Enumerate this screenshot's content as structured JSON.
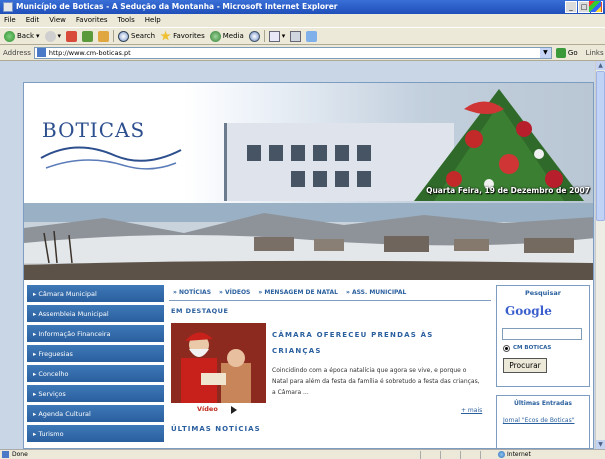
{
  "window": {
    "title": "Município de Boticas - A Sedução da Montanha - Microsoft Internet Explorer",
    "controls": [
      "_",
      "□",
      "✕"
    ]
  },
  "menu": [
    "File",
    "Edit",
    "View",
    "Favorites",
    "Tools",
    "Help"
  ],
  "toolbar": {
    "back": "Back",
    "search": "Search",
    "favorites": "Favorites",
    "media": "Media"
  },
  "address": {
    "label": "Address",
    "url": "http://www.cm-boticas.pt",
    "go": "Go",
    "links": "Links"
  },
  "site": {
    "logo": "BOTICAS",
    "date": "Quarta Feira, 19 de Dezembro de 2007",
    "nav": [
      "Câmara Municipal",
      "Assembleia Municipal",
      "Informação Financeira",
      "Freguesias",
      "Concelho",
      "Serviços",
      "Agenda Cultural",
      "Turismo"
    ],
    "tabs": [
      "NOTÍCIAS",
      "VÍDEOS",
      "MENSAGEM DE NATAL",
      "ASS. MUNICIPAL"
    ],
    "section_title": "EM DESTAQUE",
    "news": {
      "title": "CÂMARA OFERECEU PRENDAS ÀS CRIANÇAS",
      "body": "Coincidindo com a época natalícia que agora se vive, e porque o Natal para além da festa da família é sobretudo a festa das crianças, a Câmara ...",
      "video_label": "Vídeo",
      "more": "+ mais"
    },
    "latest_title": "ÚLTIMAS NOTÍCIAS",
    "search": {
      "title": "Pesquisar",
      "google": "Google",
      "radio_label": "CM BOTICAS",
      "button": "Procurar"
    },
    "latest_entries": {
      "title": "Últimas Entradas",
      "link": "Jornal \"Ecos de Boticas\""
    }
  },
  "status": {
    "text": "Done",
    "zone": "Internet"
  },
  "colors": {
    "nav_bg": "#2a5f9e",
    "accent_blue": "#2a5f9e",
    "accent_red": "#c0281c",
    "xp_title": "#1f4fb8"
  }
}
